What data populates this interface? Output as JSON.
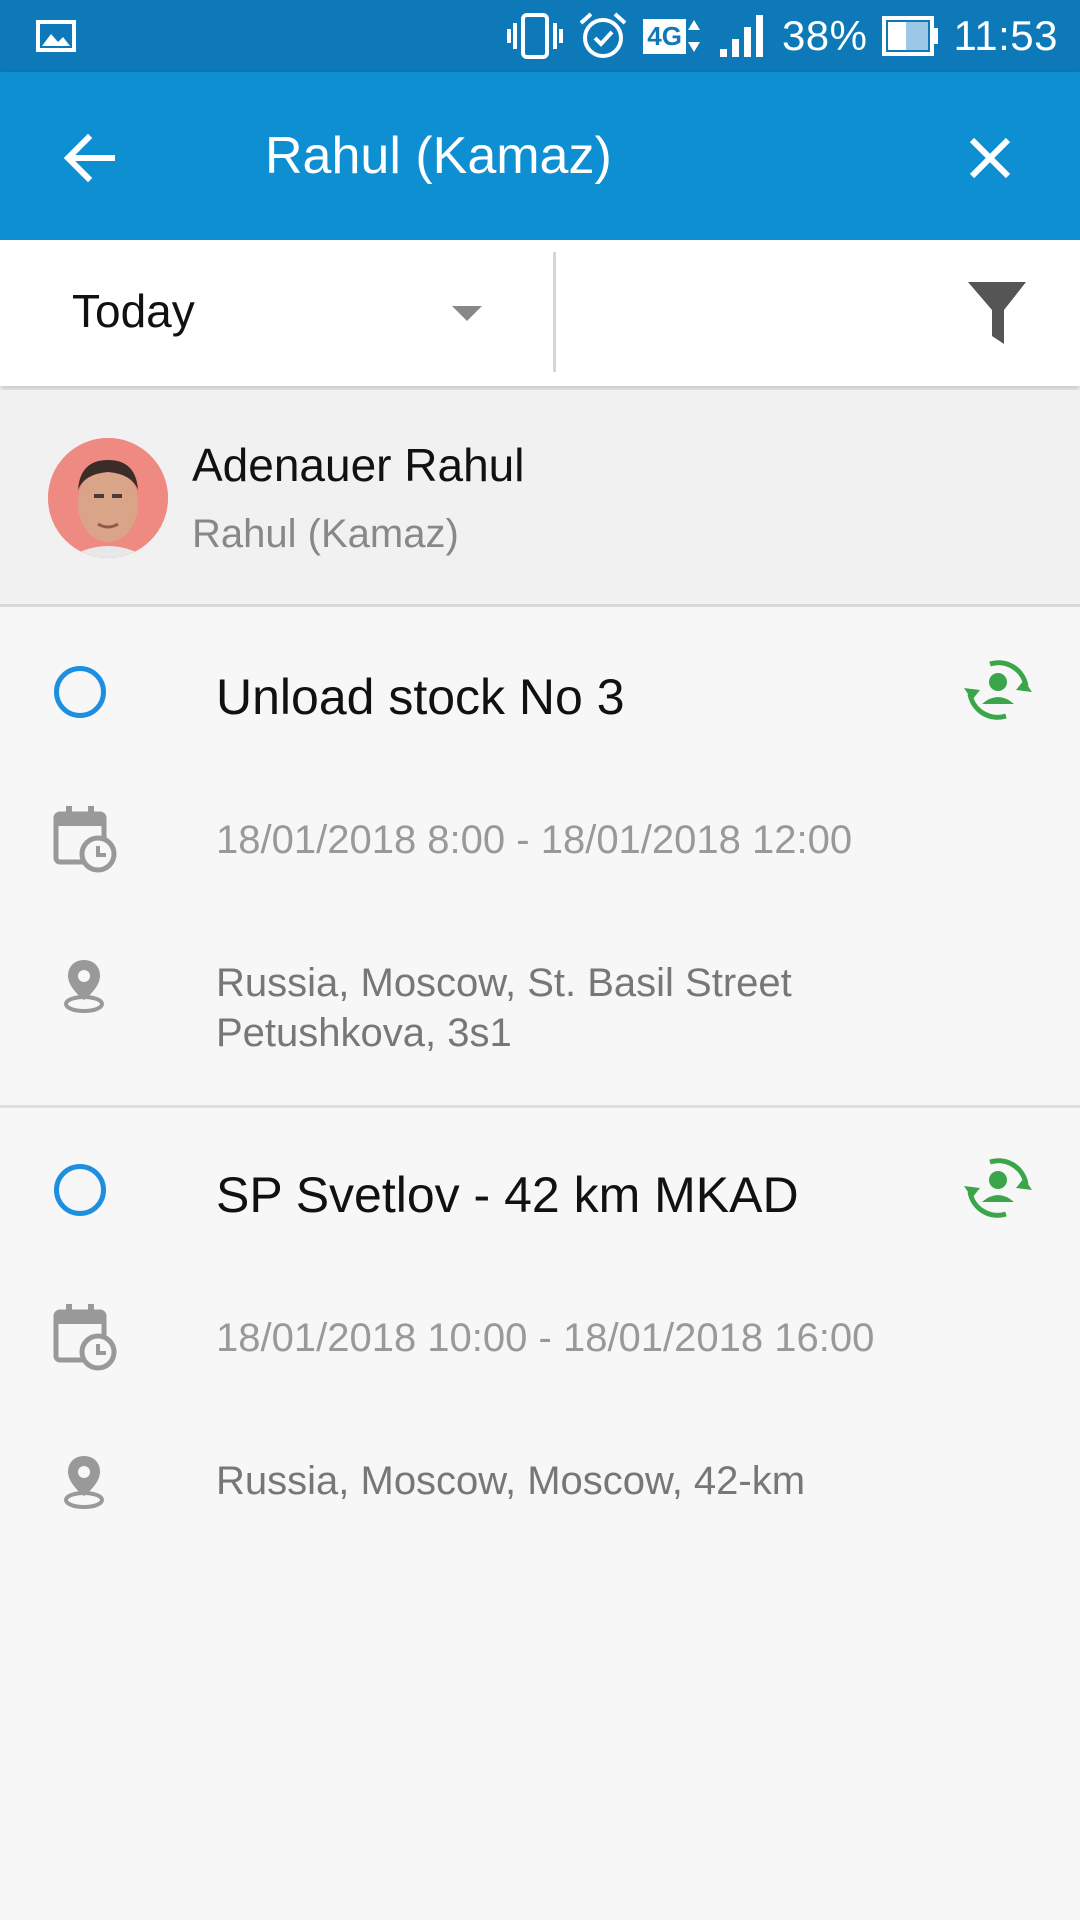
{
  "status_bar": {
    "battery": "38%",
    "time": "11:53",
    "network": "4G",
    "icons": [
      "image-icon",
      "vibrate-icon",
      "alarm-icon",
      "network-4g-icon",
      "signal-icon",
      "battery-icon"
    ]
  },
  "app_bar": {
    "title": "Rahul (Kamaz)",
    "back_icon": "arrow-left-icon",
    "close_icon": "close-icon"
  },
  "filter": {
    "period": "Today",
    "filter_icon": "funnel-icon"
  },
  "profile": {
    "name": "Adenauer Rahul",
    "subtitle": "Rahul (Kamaz)"
  },
  "tasks": [
    {
      "title": "Unload stock No 3",
      "time": "18/01/2018 8:00 - 18/01/2018 12:00",
      "address": "Russia, Moscow, St. Basil Street Petushkova, 3s1"
    },
    {
      "title": "SP Svetlov - 42 km MKAD",
      "time": "18/01/2018 10:00 - 18/01/2018 16:00",
      "address": "Russia, Moscow, Moscow, 42-km"
    }
  ],
  "colors": {
    "status_bar": "#0d79b8",
    "app_bar": "#0e8fd2",
    "task_circle": "#1e8fe0",
    "assign_icon": "#3aa54a"
  }
}
